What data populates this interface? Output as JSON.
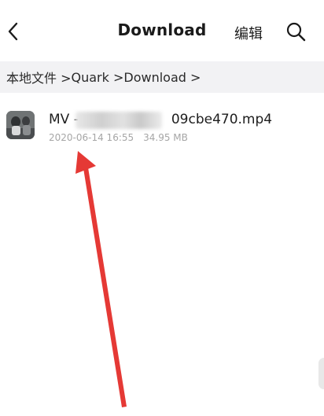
{
  "header": {
    "back_icon": "chevron-left-icon",
    "title": "Download",
    "edit_label": "编辑",
    "search_icon": "search-icon"
  },
  "breadcrumb": {
    "items": [
      "本地文件 >",
      "Quark >",
      "Download >"
    ]
  },
  "files": [
    {
      "name_prefix": "MV -",
      "name_suffix": "09cbe470.mp4",
      "date": "2020-06-14 16:55",
      "size": "34.95 MB",
      "thumb_icon": "video-thumbnail-icon"
    }
  ],
  "annotation": {
    "color": "#e53935"
  }
}
